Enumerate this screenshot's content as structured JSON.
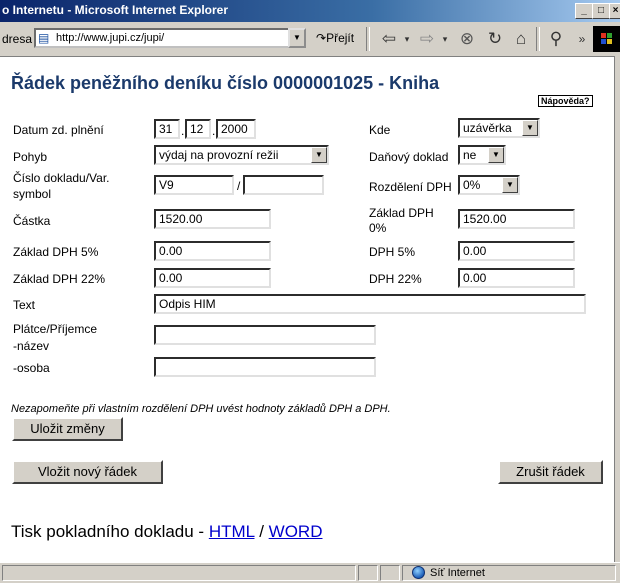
{
  "window": {
    "title": "o Internetu - Microsoft Internet Explorer",
    "minimize": "_",
    "maximize": "□",
    "close": "×"
  },
  "addressbar": {
    "label": "dresa",
    "url": "http://www.jupi.cz/jupi/",
    "go_label": "Přejít"
  },
  "page": {
    "title_prefix": "Řádek peněžního deníku číslo 0000001025 - ",
    "title_link": "Kniha",
    "help": "Nápověda?"
  },
  "form": {
    "datum_label": "Datum zd. plnění",
    "datum_day": "31",
    "datum_month": "12",
    "datum_year": "2000",
    "sep1": ".",
    "sep2": ".",
    "kde_label": "Kde",
    "kde_value": "uzávěrka",
    "pohyb_label": "Pohyb",
    "pohyb_value": "výdaj na provozní režii",
    "danovy_label": "Daňový doklad",
    "danovy_value": "ne",
    "cislo_label_1": "Číslo dokladu/Var.",
    "cislo_label_2": "symbol",
    "cislo_value": "V9",
    "cislo_sep": "/",
    "varsym_value": "",
    "rozdeleni_label": "Rozdělení DPH",
    "rozdeleni_value": "0%",
    "castka_label": "Částka",
    "castka_value": "1520.00",
    "zaklad0_label_1": "Základ DPH",
    "zaklad0_label_2": "0%",
    "zaklad0_value": "1520.00",
    "zaklad5_label": "Základ DPH 5%",
    "zaklad5_value": "0.00",
    "dph5_label": "DPH 5%",
    "dph5_value": "0.00",
    "zaklad22_label": "Základ DPH 22%",
    "zaklad22_value": "0.00",
    "dph22_label": "DPH 22%",
    "dph22_value": "0.00",
    "text_label": "Text",
    "text_value": "Odpis HIM",
    "platce_label_1": "Plátce/Příjemce",
    "platce_label_2": "-název",
    "platce_value": "",
    "osoba_label": "-osoba",
    "osoba_value": ""
  },
  "note": "Nezapomeňte při vlastním rozdělení DPH uvést hodnoty základů DPH a DPH.",
  "buttons": {
    "save": "Uložit změny",
    "insert": "Vložit nový řádek",
    "cancel": "Zrušit řádek"
  },
  "print": {
    "prefix": "Tisk pokladního dokladu - ",
    "html": "HTML",
    "slash": " / ",
    "word": "WORD"
  },
  "status": {
    "zone": "Síť Internet"
  }
}
